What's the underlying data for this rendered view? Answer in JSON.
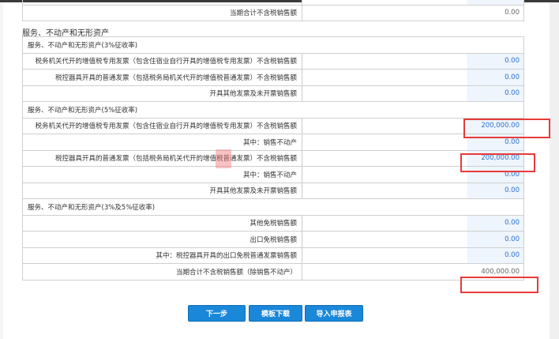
{
  "top_table": {
    "rows": [
      {
        "label": "",
        "value": ""
      },
      {
        "label": "当期合计不含税销售额",
        "value": "0.00",
        "readonly": true
      }
    ]
  },
  "section_title": "服务、不动产和无形资产",
  "main_table": {
    "rows": [
      {
        "type": "header",
        "label": "服务、不动产和无形资产(3%征收率)"
      },
      {
        "label": "税务机关代开的增值税专用发票（包含住宿业自行开具的增值税专用发票）不含税销售额",
        "value": "0.00"
      },
      {
        "label": "税控器具开具的普通发票（包括税务局机关代开的增值税普通发票）不含税销售额",
        "value": "0.00"
      },
      {
        "label": "开具其他发票及未开票销售额",
        "value": "0.00"
      },
      {
        "type": "header",
        "label": "服务、不动产和无形资产(5%征收率)"
      },
      {
        "label": "税务机关代开的增值税专用发票（包含住宿业自行开具的增值税专用发票）不含税销售额",
        "value": "200,000.00"
      },
      {
        "label": "其中：销售不动产",
        "value": "0.00"
      },
      {
        "label": "税控器具开具的普通发票（包括税务局机关代开的增值税普通发票）不含税销售额",
        "value": "200,000.00"
      },
      {
        "label": "其中：销售不动产",
        "value": "0.00"
      },
      {
        "label": "开具其他发票及未开票销售额",
        "value": "0.00"
      },
      {
        "type": "header",
        "label": "服务、不动产和无形资产(3%及5%征收率)"
      },
      {
        "label": "其他免税销售额",
        "value": "0.00"
      },
      {
        "label": "出口免税销售额",
        "value": "0.00"
      },
      {
        "label": "其中：税控器具开具的出口免税普通发票销售额",
        "value": "0.00"
      },
      {
        "label": "当期合计不含税销售额（除销售不动产）",
        "value": "400,000.00",
        "readonly": true
      }
    ]
  },
  "buttons": {
    "next": "下一步",
    "template_download": "模板下载",
    "import": "导入申报表"
  },
  "colors": {
    "button": "#1a87d9",
    "highlight": "#e83a3a",
    "input_value": "#2a6fc9"
  }
}
